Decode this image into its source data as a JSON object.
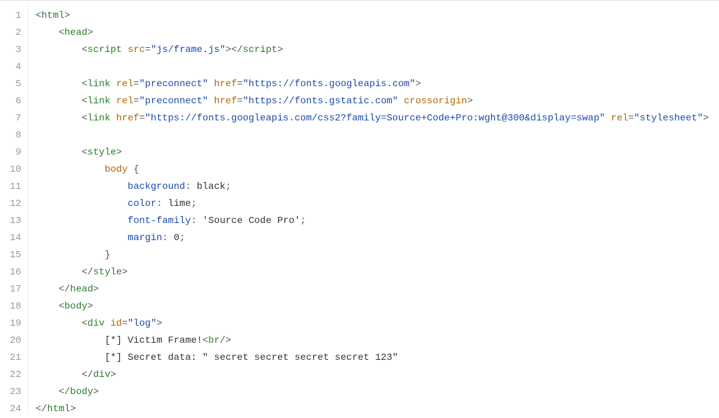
{
  "line_numbers": [
    "1",
    "2",
    "3",
    "4",
    "5",
    "6",
    "7",
    "8",
    "9",
    "10",
    "11",
    "12",
    "13",
    "14",
    "15",
    "16",
    "17",
    "18",
    "19",
    "20",
    "21",
    "22",
    "23",
    "24"
  ],
  "code": {
    "lines": [
      {
        "indent": 0,
        "segments": [
          {
            "c": "t-angle",
            "t": "<"
          },
          {
            "c": "t-tag",
            "t": "html"
          },
          {
            "c": "t-angle",
            "t": ">"
          }
        ]
      },
      {
        "indent": 1,
        "segments": [
          {
            "c": "t-angle",
            "t": "<"
          },
          {
            "c": "t-tag",
            "t": "head"
          },
          {
            "c": "t-angle",
            "t": ">"
          }
        ]
      },
      {
        "indent": 2,
        "segments": [
          {
            "c": "t-angle",
            "t": "<"
          },
          {
            "c": "t-tag",
            "t": "script"
          },
          {
            "c": "t-text",
            "t": " "
          },
          {
            "c": "t-attr",
            "t": "src"
          },
          {
            "c": "t-punc",
            "t": "="
          },
          {
            "c": "t-str",
            "t": "\"js/frame.js\""
          },
          {
            "c": "t-angle",
            "t": ">"
          },
          {
            "c": "t-angle",
            "t": "</"
          },
          {
            "c": "t-tag",
            "t": "script"
          },
          {
            "c": "t-angle",
            "t": ">"
          }
        ]
      },
      {
        "indent": 0,
        "segments": []
      },
      {
        "indent": 2,
        "segments": [
          {
            "c": "t-angle",
            "t": "<"
          },
          {
            "c": "t-tag",
            "t": "link"
          },
          {
            "c": "t-text",
            "t": " "
          },
          {
            "c": "t-attr",
            "t": "rel"
          },
          {
            "c": "t-punc",
            "t": "="
          },
          {
            "c": "t-str",
            "t": "\"preconnect\""
          },
          {
            "c": "t-text",
            "t": " "
          },
          {
            "c": "t-attr",
            "t": "href"
          },
          {
            "c": "t-punc",
            "t": "="
          },
          {
            "c": "t-str",
            "t": "\"https://fonts.googleapis.com\""
          },
          {
            "c": "t-angle",
            "t": ">"
          }
        ]
      },
      {
        "indent": 2,
        "segments": [
          {
            "c": "t-angle",
            "t": "<"
          },
          {
            "c": "t-tag",
            "t": "link"
          },
          {
            "c": "t-text",
            "t": " "
          },
          {
            "c": "t-attr",
            "t": "rel"
          },
          {
            "c": "t-punc",
            "t": "="
          },
          {
            "c": "t-str",
            "t": "\"preconnect\""
          },
          {
            "c": "t-text",
            "t": " "
          },
          {
            "c": "t-attr",
            "t": "href"
          },
          {
            "c": "t-punc",
            "t": "="
          },
          {
            "c": "t-str",
            "t": "\"https://fonts.gstatic.com\""
          },
          {
            "c": "t-text",
            "t": " "
          },
          {
            "c": "t-attr",
            "t": "crossorigin"
          },
          {
            "c": "t-angle",
            "t": ">"
          }
        ]
      },
      {
        "indent": 2,
        "segments": [
          {
            "c": "t-angle",
            "t": "<"
          },
          {
            "c": "t-tag",
            "t": "link"
          },
          {
            "c": "t-text",
            "t": " "
          },
          {
            "c": "t-attr",
            "t": "href"
          },
          {
            "c": "t-punc",
            "t": "="
          },
          {
            "c": "t-str",
            "t": "\"https://fonts.googleapis.com/css2?family=Source+Code+Pro:wght@300&display=swap\""
          },
          {
            "c": "t-text",
            "t": " "
          },
          {
            "c": "t-attr",
            "t": "rel"
          },
          {
            "c": "t-punc",
            "t": "="
          },
          {
            "c": "t-str",
            "t": "\"stylesheet\""
          },
          {
            "c": "t-angle",
            "t": ">"
          }
        ]
      },
      {
        "indent": 0,
        "segments": []
      },
      {
        "indent": 2,
        "segments": [
          {
            "c": "t-angle",
            "t": "<"
          },
          {
            "c": "t-tag",
            "t": "style"
          },
          {
            "c": "t-angle",
            "t": ">"
          }
        ]
      },
      {
        "indent": 3,
        "segments": [
          {
            "c": "t-sel",
            "t": "body"
          },
          {
            "c": "t-text",
            "t": " "
          },
          {
            "c": "t-punc",
            "t": "{"
          }
        ]
      },
      {
        "indent": 4,
        "segments": [
          {
            "c": "t-prop",
            "t": "background"
          },
          {
            "c": "t-punc",
            "t": ":"
          },
          {
            "c": "t-val",
            "t": " black"
          },
          {
            "c": "t-punc",
            "t": ";"
          }
        ]
      },
      {
        "indent": 4,
        "segments": [
          {
            "c": "t-prop",
            "t": "color"
          },
          {
            "c": "t-punc",
            "t": ":"
          },
          {
            "c": "t-val",
            "t": " lime"
          },
          {
            "c": "t-punc",
            "t": ";"
          }
        ]
      },
      {
        "indent": 4,
        "segments": [
          {
            "c": "t-prop",
            "t": "font-family"
          },
          {
            "c": "t-punc",
            "t": ":"
          },
          {
            "c": "t-val",
            "t": " 'Source Code Pro'"
          },
          {
            "c": "t-punc",
            "t": ";"
          }
        ]
      },
      {
        "indent": 4,
        "segments": [
          {
            "c": "t-prop",
            "t": "margin"
          },
          {
            "c": "t-punc",
            "t": ":"
          },
          {
            "c": "t-val",
            "t": " 0"
          },
          {
            "c": "t-punc",
            "t": ";"
          }
        ]
      },
      {
        "indent": 3,
        "segments": [
          {
            "c": "t-punc",
            "t": "}"
          }
        ]
      },
      {
        "indent": 2,
        "segments": [
          {
            "c": "t-angle",
            "t": "</"
          },
          {
            "c": "t-tag",
            "t": "style"
          },
          {
            "c": "t-angle",
            "t": ">"
          }
        ]
      },
      {
        "indent": 1,
        "segments": [
          {
            "c": "t-angle",
            "t": "</"
          },
          {
            "c": "t-tag",
            "t": "head"
          },
          {
            "c": "t-angle",
            "t": ">"
          }
        ]
      },
      {
        "indent": 1,
        "segments": [
          {
            "c": "t-angle",
            "t": "<"
          },
          {
            "c": "t-tag",
            "t": "body"
          },
          {
            "c": "t-angle",
            "t": ">"
          }
        ]
      },
      {
        "indent": 2,
        "segments": [
          {
            "c": "t-angle",
            "t": "<"
          },
          {
            "c": "t-tag",
            "t": "div"
          },
          {
            "c": "t-text",
            "t": " "
          },
          {
            "c": "t-attr",
            "t": "id"
          },
          {
            "c": "t-punc",
            "t": "="
          },
          {
            "c": "t-str",
            "t": "\"log\""
          },
          {
            "c": "t-angle",
            "t": ">"
          }
        ]
      },
      {
        "indent": 3,
        "segments": [
          {
            "c": "t-text",
            "t": "[*] Victim Frame!"
          },
          {
            "c": "t-angle",
            "t": "<"
          },
          {
            "c": "t-tag",
            "t": "br"
          },
          {
            "c": "t-angle",
            "t": "/>"
          }
        ]
      },
      {
        "indent": 3,
        "segments": [
          {
            "c": "t-text",
            "t": "[*] Secret data: \" secret secret secret secret 123\""
          }
        ]
      },
      {
        "indent": 2,
        "segments": [
          {
            "c": "t-angle",
            "t": "</"
          },
          {
            "c": "t-tag",
            "t": "div"
          },
          {
            "c": "t-angle",
            "t": ">"
          }
        ]
      },
      {
        "indent": 1,
        "segments": [
          {
            "c": "t-angle",
            "t": "</"
          },
          {
            "c": "t-tag",
            "t": "body"
          },
          {
            "c": "t-angle",
            "t": ">"
          }
        ]
      },
      {
        "indent": 0,
        "segments": [
          {
            "c": "t-angle",
            "t": "</"
          },
          {
            "c": "t-tag",
            "t": "html"
          },
          {
            "c": "t-angle",
            "t": ">"
          }
        ]
      }
    ]
  }
}
